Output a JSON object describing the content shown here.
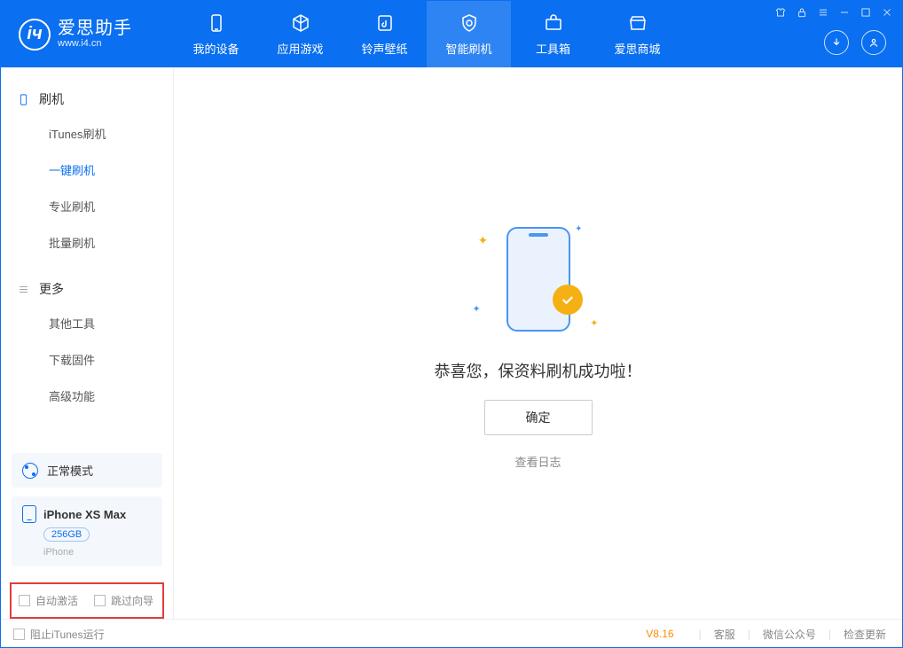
{
  "logo": {
    "title": "爱思助手",
    "subtitle": "www.i4.cn"
  },
  "nav": {
    "device": "我的设备",
    "apps": "应用游戏",
    "ring": "铃声壁纸",
    "flash": "智能刷机",
    "tools": "工具箱",
    "store": "爱思商城"
  },
  "sidebar": {
    "group_flash": "刷机",
    "items_flash": {
      "itunes": "iTunes刷机",
      "onekey": "一键刷机",
      "pro": "专业刷机",
      "batch": "批量刷机"
    },
    "group_more": "更多",
    "items_more": {
      "other": "其他工具",
      "firmware": "下载固件",
      "advanced": "高级功能"
    }
  },
  "device": {
    "mode": "正常模式",
    "name": "iPhone XS Max",
    "capacity": "256GB",
    "type": "iPhone"
  },
  "options": {
    "auto_activate": "自动激活",
    "skip_guide": "跳过向导"
  },
  "main": {
    "success": "恭喜您，保资料刷机成功啦！",
    "ok": "确定",
    "view_log": "查看日志"
  },
  "footer": {
    "block_itunes": "阻止iTunes运行",
    "version": "V8.16",
    "support": "客服",
    "wechat": "微信公众号",
    "update": "检查更新"
  }
}
